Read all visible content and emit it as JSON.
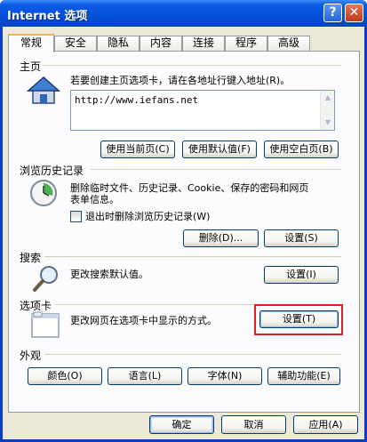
{
  "window": {
    "title": "Internet 选项",
    "help_label": "?",
    "close_label": "✕"
  },
  "tabs": [
    "常规",
    "安全",
    "隐私",
    "内容",
    "连接",
    "程序",
    "高级"
  ],
  "home": {
    "group_title": "主页",
    "description": "若要创建主页选项卡，请在各地址行键入地址(R)。",
    "url_value": "http://www.iefans.net",
    "buttons": [
      "使用当前页(C)",
      "使用默认值(F)",
      "使用空白页(B)"
    ]
  },
  "history": {
    "group_title": "浏览历史记录",
    "description_line1": "删除临时文件、历史记录、Cookie、保存的密码和网页",
    "description_line2": "表单信息。",
    "checkbox_label": "退出时删除浏览历史记录(W)",
    "delete_button": "删除(D)...",
    "settings_button": "设置(S)"
  },
  "search": {
    "group_title": "搜索",
    "description": "更改搜索默认值。",
    "settings_button": "设置(I)"
  },
  "tabs_group": {
    "group_title": "选项卡",
    "description": "更改网页在选项卡中显示的方式。",
    "settings_button": "设置(T)"
  },
  "appearance": {
    "group_title": "外观",
    "buttons": [
      "颜色(O)",
      "语言(L)",
      "字体(N)",
      "辅助功能(E)"
    ]
  },
  "footer": {
    "ok": "确定",
    "cancel": "取消",
    "apply": "应用(A)"
  },
  "colors": {
    "highlight_border": "#e02020",
    "title_bar": "#0650d8",
    "active_tab_accent": "#f7b248"
  }
}
